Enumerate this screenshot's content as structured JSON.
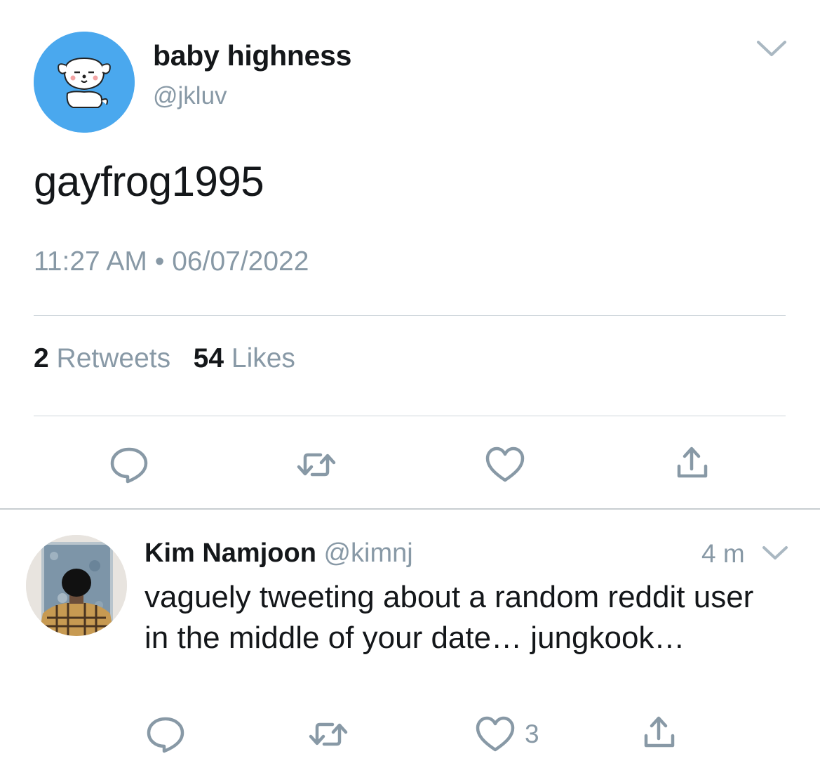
{
  "tweet": {
    "author_name": "baby highness",
    "author_handle": "@jkluv",
    "text": "gayfrog1995",
    "time": "11:27 AM",
    "separator": "•",
    "date": "06/07/2022",
    "retweet_count": "2",
    "retweet_label": "Retweets",
    "like_count": "54",
    "like_label": "Likes",
    "avatar_icon": "cartoon-dog-avatar",
    "actions": [
      "reply-icon",
      "retweet-icon",
      "like-icon",
      "share-icon"
    ]
  },
  "reply": {
    "author_name": "Kim Namjoon",
    "author_handle": "@kimnj",
    "time": "4 m",
    "text": "vaguely tweeting about a random reddit user in the middle of your date… jungkook…",
    "like_count": "3",
    "avatar_icon": "person-photo-avatar",
    "actions": [
      "reply-icon",
      "retweet-icon",
      "like-icon",
      "share-icon"
    ]
  },
  "colors": {
    "avatar_bg": "#4aa8ee",
    "muted_text": "#8899a6",
    "icon_gray": "#8899a6",
    "divider": "#cfd6dc"
  }
}
